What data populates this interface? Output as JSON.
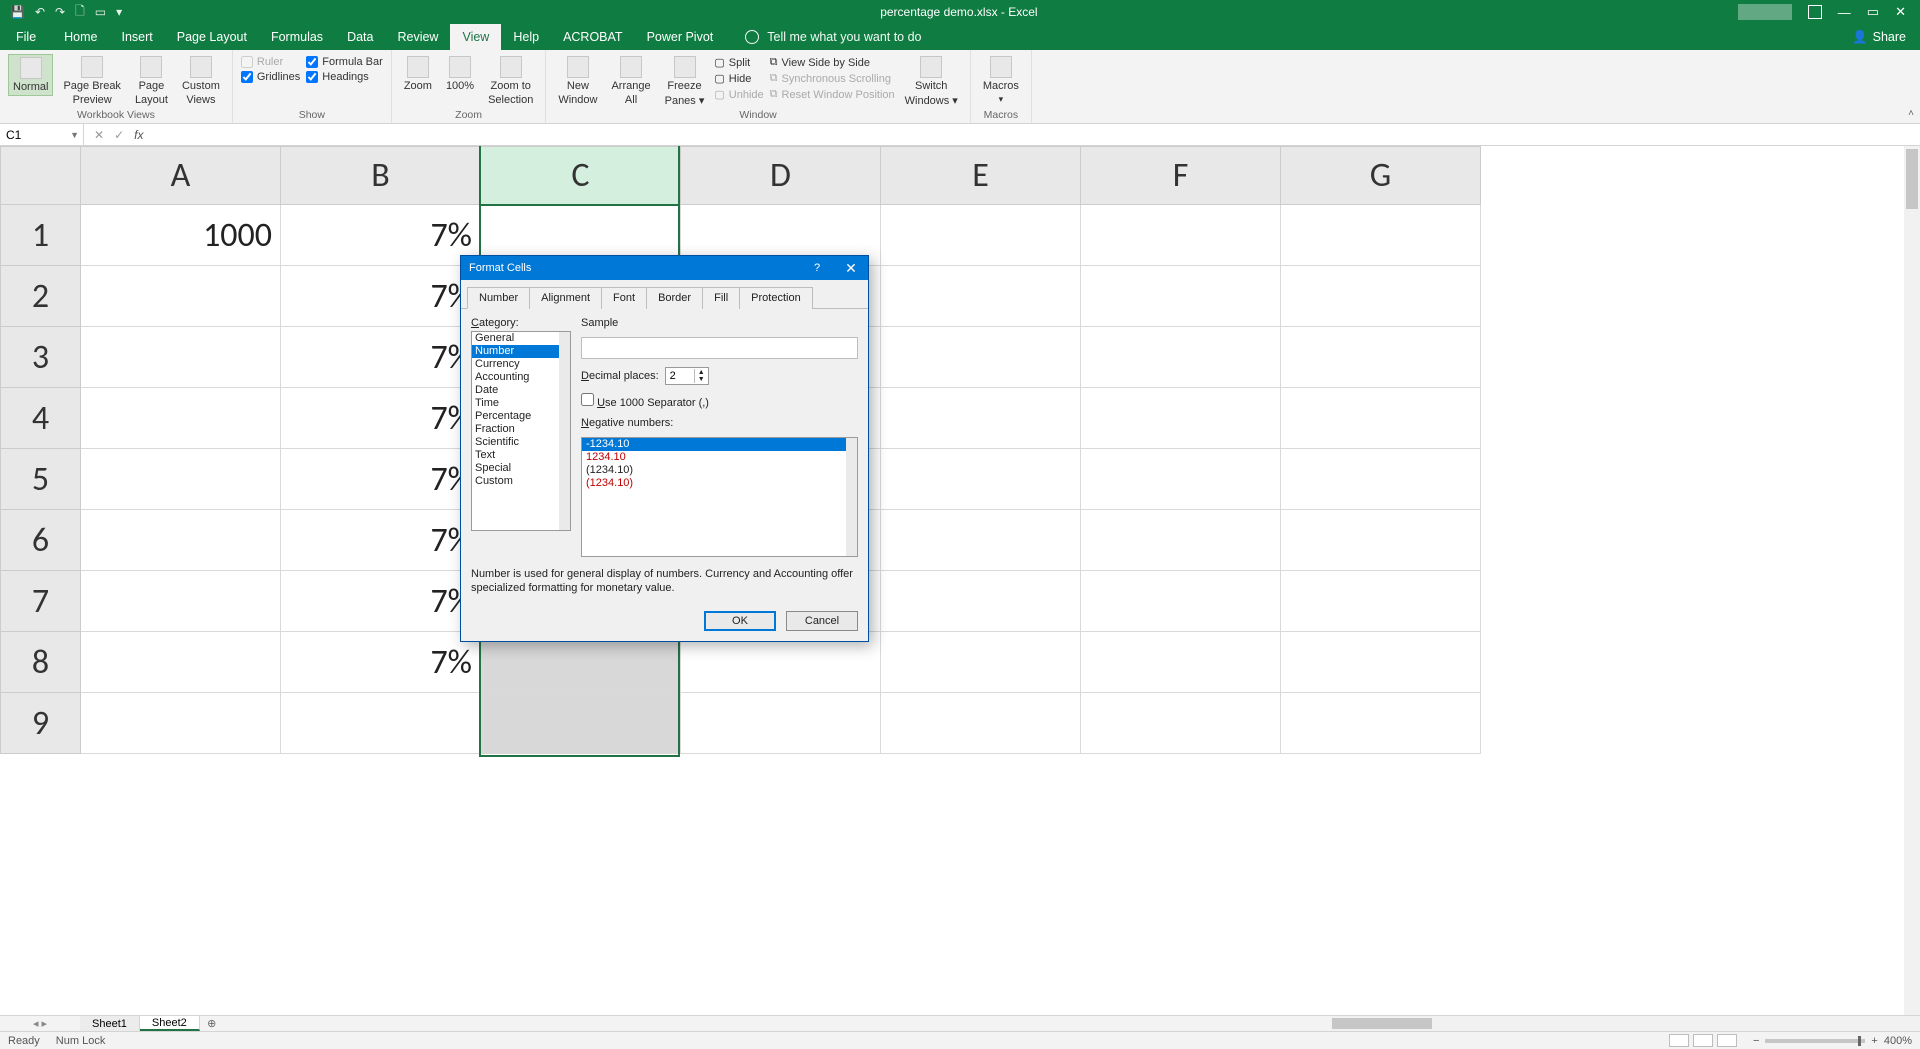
{
  "titlebar": {
    "title": "percentage demo.xlsx - Excel",
    "qat_save": "💾",
    "qat_undo": "↶",
    "qat_redo": "↷",
    "qat_new": "🗋",
    "qat_touch": "▭",
    "qat_custom": "▾"
  },
  "tabs": {
    "file": "File",
    "home": "Home",
    "insert": "Insert",
    "pagelayout": "Page Layout",
    "formulas": "Formulas",
    "data": "Data",
    "review": "Review",
    "view": "View",
    "help": "Help",
    "acrobat": "ACROBAT",
    "powerpivot": "Power Pivot",
    "tellme": "Tell me what you want to do",
    "share": "Share"
  },
  "ribbon": {
    "workbookviews": {
      "name": "Workbook Views",
      "normal": "Normal",
      "pbpreview_l1": "Page Break",
      "pbpreview_l2": "Preview",
      "pagelayout_l1": "Page",
      "pagelayout_l2": "Layout",
      "custom_l1": "Custom",
      "custom_l2": "Views"
    },
    "show": {
      "name": "Show",
      "ruler": "Ruler",
      "formulabar": "Formula Bar",
      "gridlines": "Gridlines",
      "headings": "Headings"
    },
    "zoom": {
      "name": "Zoom",
      "zoom": "Zoom",
      "hundred": "100%",
      "zoomsel_l1": "Zoom to",
      "zoomsel_l2": "Selection"
    },
    "window": {
      "name": "Window",
      "newwin_l1": "New",
      "newwin_l2": "Window",
      "arrange_l1": "Arrange",
      "arrange_l2": "All",
      "freeze_l1": "Freeze",
      "freeze_l2": "Panes ▾",
      "split": "Split",
      "hide": "Hide",
      "unhide": "Unhide",
      "viewsbs": "View Side by Side",
      "syncscroll": "Synchronous Scrolling",
      "resetpos": "Reset Window Position",
      "switch_l1": "Switch",
      "switch_l2": "Windows ▾"
    },
    "macros": {
      "name": "Macros",
      "macros_l1": "Macros",
      "macros_l2": "▾"
    }
  },
  "namebox": {
    "value": "C1"
  },
  "formula": {
    "cancel": "✕",
    "confirm": "✓",
    "fx": "fx",
    "value": ""
  },
  "columns": [
    "A",
    "B",
    "C",
    "D",
    "E",
    "F",
    "G"
  ],
  "rows": [
    "1",
    "2",
    "3",
    "4",
    "5",
    "6",
    "7",
    "8",
    "9"
  ],
  "cells": {
    "A1": "1000",
    "B1": "7%",
    "B2": "7%",
    "B3": "7%",
    "B4": "7%",
    "B5": "7%",
    "B6": "7%",
    "B7": "7%",
    "B8": "7%"
  },
  "sheets": {
    "s1": "Sheet1",
    "s2": "Sheet2",
    "add": "⊕"
  },
  "status": {
    "ready": "Ready",
    "numlock": "Num Lock",
    "zoom_minus": "−",
    "zoom_plus": "+",
    "zoom_val": "400%"
  },
  "dialog": {
    "title": "Format Cells",
    "help": "?",
    "close": "✕",
    "tabs": {
      "number": "Number",
      "alignment": "Alignment",
      "font": "Font",
      "border": "Border",
      "fill": "Fill",
      "protection": "Protection"
    },
    "category_label": "Category:",
    "categories": [
      "General",
      "Number",
      "Currency",
      "Accounting",
      "Date",
      "Time",
      "Percentage",
      "Fraction",
      "Scientific",
      "Text",
      "Special",
      "Custom"
    ],
    "sample_label": "Sample",
    "decimal_label": "Decimal places:",
    "decimal_value": "2",
    "thousand_label": "Use 1000 Separator (,)",
    "negative_label": "Negative numbers:",
    "neg0": "-1234.10",
    "neg1": "1234.10",
    "neg2": "(1234.10)",
    "neg3": "(1234.10)",
    "description": "Number is used for general display of numbers.  Currency and Accounting offer specialized formatting for monetary value.",
    "ok": "OK",
    "cancel": "Cancel"
  }
}
